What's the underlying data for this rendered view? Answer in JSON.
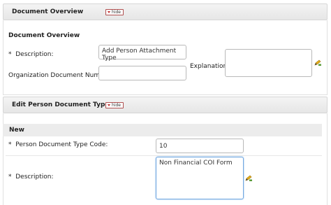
{
  "document_overview_panel": {
    "header_title": "Document Overview",
    "hide_label": "hide",
    "section_title": "Document Overview",
    "description": {
      "required_marker": "*",
      "label": "Description:",
      "value": "Add Person Attachment Type"
    },
    "org_doc_number": {
      "label": "Organization Document Number:",
      "value": ""
    },
    "explanation": {
      "label": "Explanation:",
      "value": ""
    }
  },
  "edit_panel": {
    "header_title": "Edit Person Document Type",
    "hide_label": "hide",
    "section_title": "New",
    "type_code": {
      "required_marker": "*",
      "label": "Person Document Type Code:",
      "value": "10"
    },
    "description": {
      "required_marker": "*",
      "label": "Description:",
      "value": "Non Financial COI Form"
    }
  },
  "icons": {
    "expand": "pencil-expand-icon"
  }
}
